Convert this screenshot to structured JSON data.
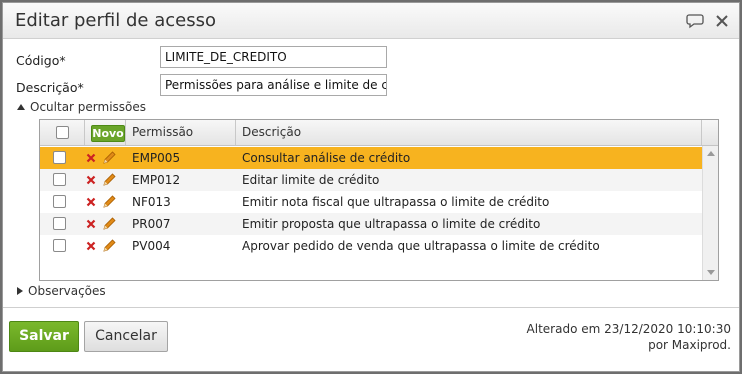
{
  "dialog": {
    "title": "Editar perfil de acesso",
    "chat_icon": "speech-bubble-icon",
    "close_icon": "close-icon"
  },
  "form": {
    "codigo_label": "Código*",
    "codigo_value": "LIMITE_DE_CREDITO",
    "descricao_label": "Descrição*",
    "descricao_value": "Permissões para análise e limite de cr"
  },
  "permissions": {
    "toggle_label": "Ocultar permissões",
    "novo_label": "Novo",
    "columns": [
      "Permissão",
      "Descrição"
    ],
    "rows": [
      {
        "code": "EMP005",
        "description": "Consultar análise de crédito",
        "selected": true
      },
      {
        "code": "EMP012",
        "description": "Editar limite de crédito",
        "selected": false
      },
      {
        "code": "NF013",
        "description": "Emitir nota fiscal que ultrapassa o limite de crédito",
        "selected": false
      },
      {
        "code": "PR007",
        "description": "Emitir proposta que ultrapassa o limite de crédito",
        "selected": false
      },
      {
        "code": "PV004",
        "description": "Aprovar pedido de venda que ultrapassa o limite de crédito",
        "selected": false
      }
    ]
  },
  "observacoes": {
    "toggle_label": "Observações"
  },
  "footer": {
    "save_label": "Salvar",
    "cancel_label": "Cancelar",
    "audit_line1": "Alterado em 23/12/2020 10:10:30",
    "audit_line2": "por Maxiprod."
  },
  "colors": {
    "selected_row": "#f7b31f",
    "save_button": "#6aa52a",
    "delete_icon": "#cc2222",
    "edit_icon": "#e08a18"
  }
}
